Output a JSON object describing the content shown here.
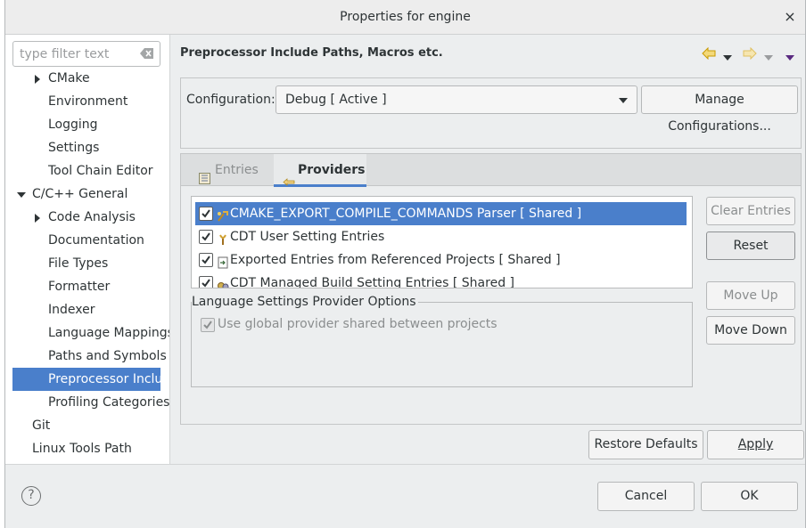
{
  "window": {
    "title": "Properties for engine",
    "close_glyph": "×"
  },
  "filter": {
    "placeholder": "type filter text"
  },
  "tree": [
    {
      "label": "CMake",
      "indent": 2,
      "arrow": "right"
    },
    {
      "label": "Environment",
      "indent": 2
    },
    {
      "label": "Logging",
      "indent": 2
    },
    {
      "label": "Settings",
      "indent": 2
    },
    {
      "label": "Tool Chain Editor",
      "indent": 2
    },
    {
      "label": "C/C++ General",
      "indent": 1,
      "arrow": "down"
    },
    {
      "label": "Code Analysis",
      "indent": 2,
      "arrow": "right"
    },
    {
      "label": "Documentation",
      "indent": 2
    },
    {
      "label": "File Types",
      "indent": 2
    },
    {
      "label": "Formatter",
      "indent": 2
    },
    {
      "label": "Indexer",
      "indent": 2
    },
    {
      "label": "Language Mappings",
      "indent": 2
    },
    {
      "label": "Paths and Symbols",
      "indent": 2
    },
    {
      "label": "Preprocessor Include Paths, Macros etc.",
      "indent": 2,
      "selected": true
    },
    {
      "label": "Profiling Categories",
      "indent": 2
    },
    {
      "label": "Git",
      "indent": 1
    },
    {
      "label": "Linux Tools Path",
      "indent": 1
    }
  ],
  "page": {
    "title": "Preprocessor Include Paths, Macros etc."
  },
  "config": {
    "label": "Configuration:",
    "value": "Debug  [ Active ]",
    "manage_button": "Manage Configurations..."
  },
  "tabs": [
    {
      "label": "Entries",
      "active": false
    },
    {
      "label": "Providers",
      "active": true
    }
  ],
  "providers": [
    {
      "label": "CMAKE_EXPORT_COMPILE_COMMANDS Parser   [ Shared ]",
      "checked": true,
      "selected": true,
      "icon": "parser-icon"
    },
    {
      "label": "CDT User Setting Entries",
      "checked": true,
      "selected": false,
      "icon": "user-entries-icon"
    },
    {
      "label": "Exported Entries from Referenced Projects   [ Shared ]",
      "checked": true,
      "selected": false,
      "icon": "exported-entries-icon"
    },
    {
      "label": "CDT Managed Build Setting Entries   [ Shared ]",
      "checked": true,
      "selected": false,
      "icon": "managed-build-icon"
    }
  ],
  "side_buttons": {
    "clear": "Clear Entries",
    "reset": "Reset",
    "move_up": "Move Up",
    "move_down": "Move Down"
  },
  "options": {
    "legend": "Language Settings Provider Options",
    "global_provider": "Use global provider shared between projects"
  },
  "footer": {
    "restore": "Restore Defaults",
    "apply": "Apply",
    "cancel": "Cancel",
    "ok": "OK",
    "help": "?"
  },
  "colors": {
    "selection": "#4a7fcb",
    "nav_arrow": "#e0a000"
  }
}
